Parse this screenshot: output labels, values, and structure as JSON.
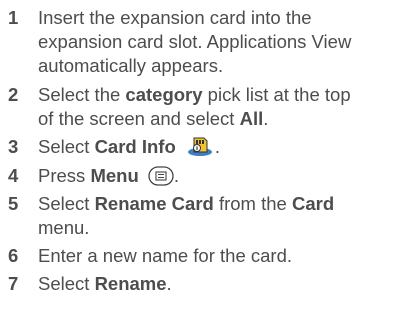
{
  "steps": [
    {
      "number": "1",
      "line1": "Insert the expansion card into the",
      "line2": "expansion card slot. Applications View",
      "line3": "automatically appears."
    },
    {
      "number": "2",
      "line1_a": "Select the ",
      "line1_b": "category",
      "line1_c": " pick list at the top",
      "line2_a": "of the screen and select ",
      "line2_b": "All",
      "line2_c": "."
    },
    {
      "number": "3",
      "a": "Select ",
      "b": "Card Info",
      "c": "."
    },
    {
      "number": "4",
      "a": "Press ",
      "b": "Menu",
      "c": "."
    },
    {
      "number": "5",
      "line1_a": "Select ",
      "line1_b": "Rename Card",
      "line1_c": " from the ",
      "line1_d": "Card",
      "line2": "menu."
    },
    {
      "number": "6",
      "text": "Enter a new name for the card."
    },
    {
      "number": "7",
      "a": "Select ",
      "b": "Rename",
      "c": "."
    }
  ],
  "icons": {
    "card_info": "card-info-icon",
    "menu": "menu-key-icon"
  }
}
